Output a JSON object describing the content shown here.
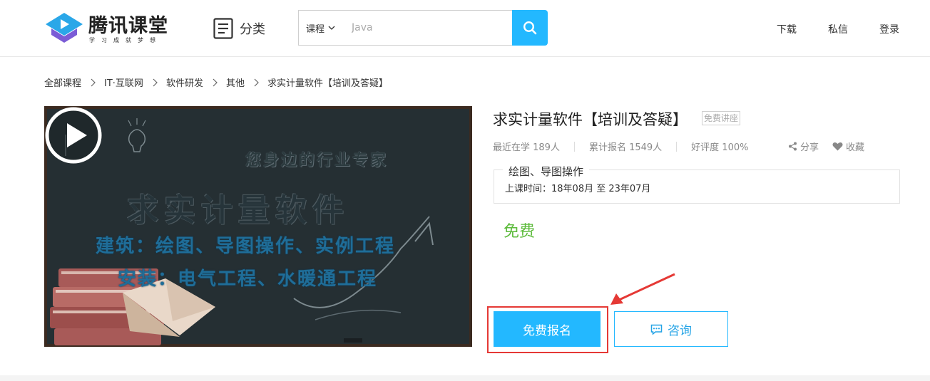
{
  "header": {
    "logo_title": "腾讯课堂",
    "logo_subtitle": "学习成就梦想",
    "category_label": "分类",
    "search": {
      "type_selected": "课程",
      "placeholder": "Java"
    },
    "links": [
      "下载",
      "私信",
      "登录"
    ]
  },
  "breadcrumb": [
    "全部课程",
    "IT·互联网",
    "软件研发",
    "其他",
    "求实计量软件【培训及答疑】"
  ],
  "cover": {
    "tagline": "您身边的行业专家",
    "title": "求实计量软件",
    "line1": "建筑：绘图、导图操作、实例工程",
    "line2": "安装：电气工程、水暖通工程",
    "idea_text": "IDEA!"
  },
  "course": {
    "title": "求实计量软件【培训及答疑】",
    "tag": "免费讲座",
    "stats": {
      "recent": "最近在学 189人",
      "total": "累计报名 1549人",
      "rating": "好评度 100%"
    },
    "share_label": "分享",
    "favorite_label": "收藏",
    "schedule_title": "绘图、导图操作",
    "schedule_time": "上课时间：18年08月 至 23年07月",
    "price": "免费",
    "enroll_label": "免费报名",
    "consult_label": "咨询"
  },
  "colors": {
    "accent": "#23b8ff",
    "price": "#5dbb3c",
    "highlight": "#e53935"
  }
}
